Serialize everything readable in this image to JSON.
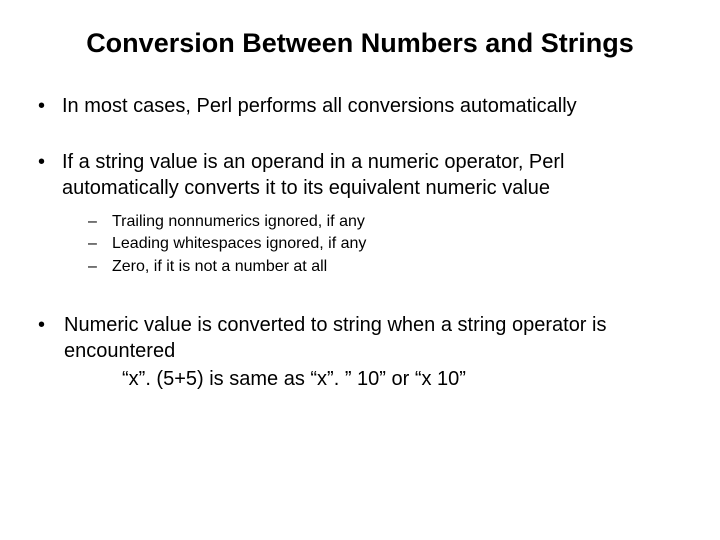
{
  "title": "Conversion Between Numbers and Strings",
  "bullet1": "In most cases, Perl performs all conversions automatically",
  "bullet2": "If a string value is an operand in a numeric operator, Perl automatically converts it to its equivalent numeric value",
  "sub": {
    "a": "Trailing nonnumerics ignored, if any",
    "b": "Leading whitespaces ignored, if any",
    "c": "Zero, if it is not a number at all"
  },
  "bullet3_line1": " Numeric value is converted to string when a string operator is encountered",
  "bullet3_line2": "“x”. (5+5) is same as “x”. ” 10” or “x 10”",
  "glyph": {
    "dot": "•",
    "dash": "–"
  }
}
